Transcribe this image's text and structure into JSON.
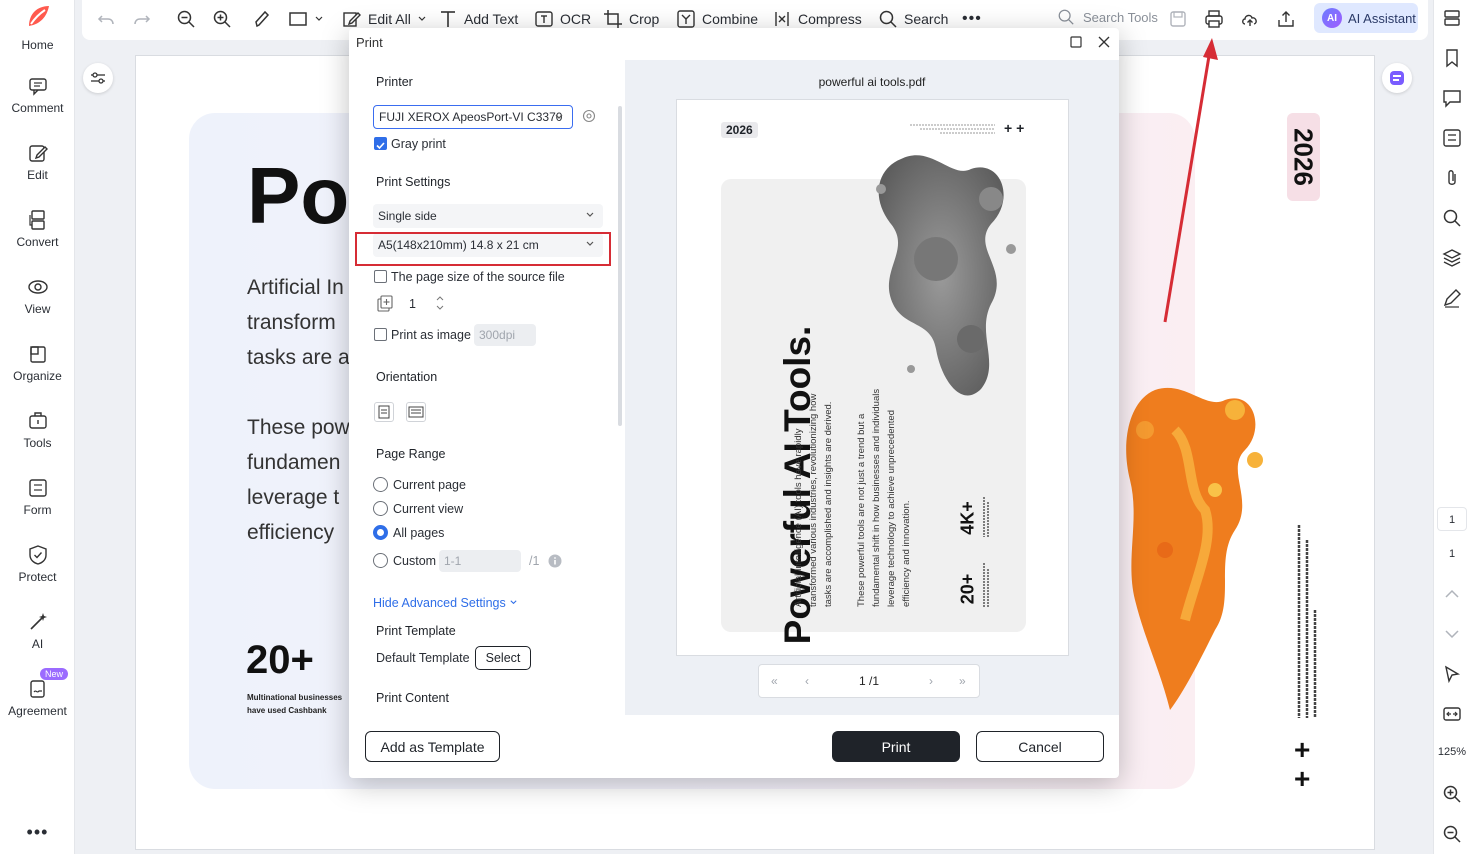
{
  "sidebar": {
    "items": [
      {
        "label": "Home",
        "icon": "home-logo-icon"
      },
      {
        "label": "Comment",
        "icon": "comment-icon"
      },
      {
        "label": "Edit",
        "icon": "edit-icon"
      },
      {
        "label": "Convert",
        "icon": "convert-icon"
      },
      {
        "label": "View",
        "icon": "view-icon"
      },
      {
        "label": "Organize",
        "icon": "organize-icon"
      },
      {
        "label": "Tools",
        "icon": "tools-icon"
      },
      {
        "label": "Form",
        "icon": "form-icon"
      },
      {
        "label": "Protect",
        "icon": "protect-icon"
      },
      {
        "label": "AI",
        "icon": "ai-wand-icon"
      },
      {
        "label": "Agreement",
        "icon": "agreement-icon"
      }
    ],
    "new_badge": "New"
  },
  "toolbar": {
    "edit_all": "Edit All",
    "add_text": "Add Text",
    "ocr": "OCR",
    "crop": "Crop",
    "combine": "Combine",
    "compress": "Compress",
    "search": "Search",
    "search_tools_placeholder": "Search Tools",
    "ai_badge": "AI",
    "ai_assistant": "AI Assistant"
  },
  "right_panel": {
    "page_current": "1",
    "page_total": "1",
    "zoom": "125%"
  },
  "document": {
    "title_partial": "Po",
    "para1": [
      "Artificial In",
      "transform",
      "tasks are a"
    ],
    "para2": [
      "These pow",
      "fundamen",
      "leverage t",
      "efficiency"
    ],
    "stat": "20+",
    "stat_caption": "Multinational businesses have used Cashbank",
    "year": "2026"
  },
  "dialog": {
    "title": "Print",
    "printer_heading": "Printer",
    "printer_value": "FUJI XEROX ApeosPort-VI C3370",
    "gray_print": "Gray print",
    "print_settings_heading": "Print Settings",
    "side_value": "Single side",
    "paper_value": "A5(148x210mm) 14.8 x 21 cm",
    "source_size": "The page size of the source file",
    "copies": "1",
    "print_as_image": "Print as image",
    "dpi_value": "300dpi",
    "orientation_heading": "Orientation",
    "page_range_heading": "Page Range",
    "range_current_page": "Current page",
    "range_current_view": "Current view",
    "range_all_pages": "All pages",
    "range_custom": "Custom",
    "custom_placeholder": "1-1",
    "custom_total": "/1",
    "advanced_link": "Hide Advanced Settings",
    "print_template_heading": "Print Template",
    "default_template": "Default Template",
    "select_button": "Select",
    "print_content_heading": "Print Content",
    "add_template_button": "Add as Template",
    "print_button": "Print",
    "cancel_button": "Cancel"
  },
  "preview": {
    "file_name": "powerful ai tools.pdf",
    "year": "2026",
    "plus": "+ +",
    "title": "Powerful AI Tools.",
    "col1": [
      "Artificial Intelligence (AI) tools have rapidly",
      "transformed various industries, revolutionizing how",
      "tasks are accomplished and insights are derived."
    ],
    "col2": [
      "These powerful tools are not just a trend but a",
      "fundamental shift in how businesses and individuals",
      "leverage technology to achieve unprecedented",
      "efficiency and innovation."
    ],
    "stat1": "4K+",
    "stat2": "20+",
    "page_indicator": "1 /1"
  },
  "colors": {
    "accent": "#2f6ee8",
    "highlight": "#d62c35",
    "dark_button": "#1f2329"
  }
}
